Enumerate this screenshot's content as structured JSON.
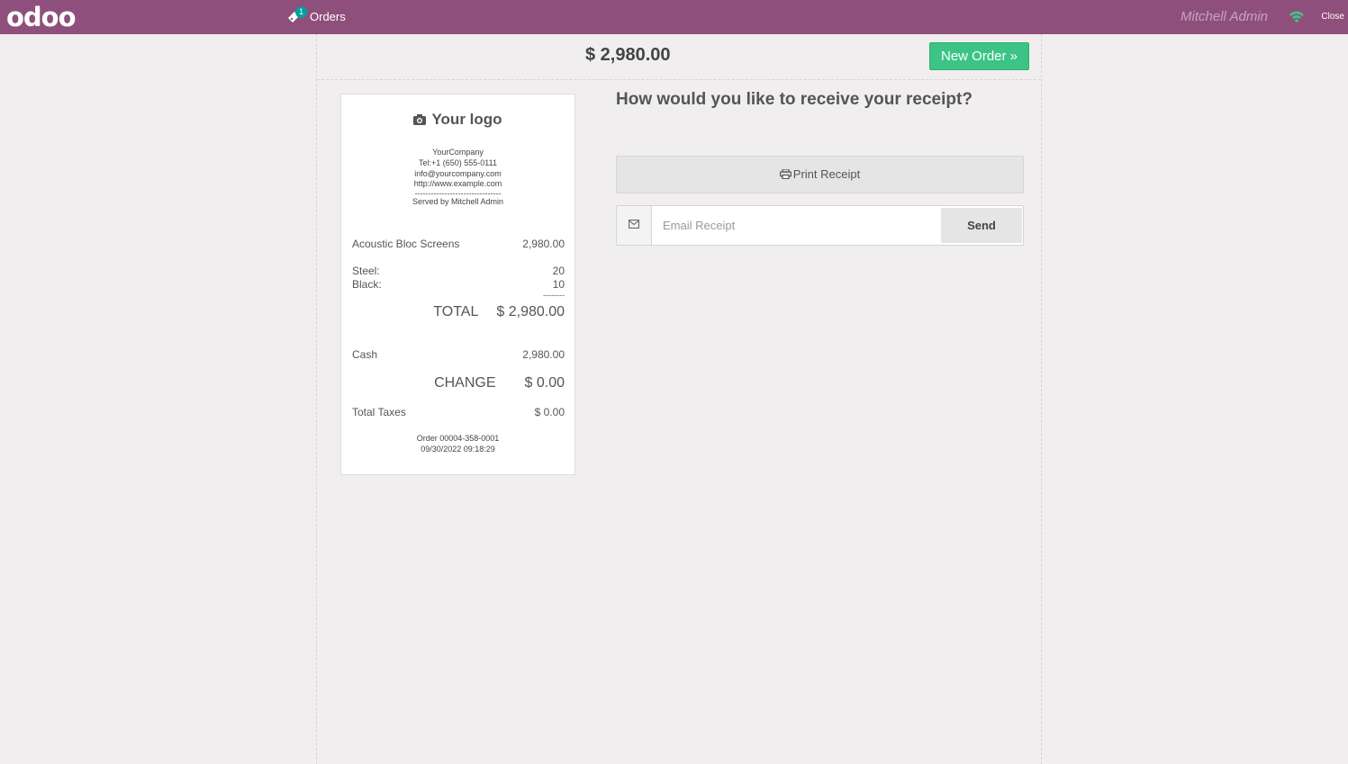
{
  "topbar": {
    "logo": "odoo",
    "orders_label": "Orders",
    "orders_badge": "1",
    "user_name": "Mitchell Admin",
    "close_label": "Close",
    "colors": {
      "bar": "#8f4f7c",
      "badge": "#00a09d",
      "wifi": "#3cc486"
    }
  },
  "header": {
    "total": "$ 2,980.00",
    "new_order_label": "New Order »"
  },
  "receipt": {
    "logo_text": "Your logo",
    "company": "YourCompany",
    "phone": "Tel:+1 (650) 555-0111",
    "email": "info@yourcompany.com",
    "website": "http://www.example.com",
    "separator": "--------------------------------",
    "served_by": "Served by Mitchell Admin",
    "product": {
      "name": "Acoustic Bloc Screens",
      "price": "2,980.00"
    },
    "attributes": [
      {
        "name": "Steel:",
        "value": "20"
      },
      {
        "name": "Black:",
        "value": "10"
      }
    ],
    "attr_dash": "--------",
    "total_label": "TOTAL",
    "total_value": "$ 2,980.00",
    "payment": {
      "name": "Cash",
      "value": "2,980.00"
    },
    "change_label": "CHANGE",
    "change_value": "$ 0.00",
    "taxes_label": "Total Taxes",
    "taxes_value": "$ 0.00",
    "order_ref": "Order 00004-358-0001",
    "order_date": "09/30/2022 09:18:29"
  },
  "panel": {
    "question": "How would you like to receive your receipt?",
    "print_label": "Print Receipt",
    "email_placeholder": "Email Receipt",
    "send_label": "Send"
  }
}
